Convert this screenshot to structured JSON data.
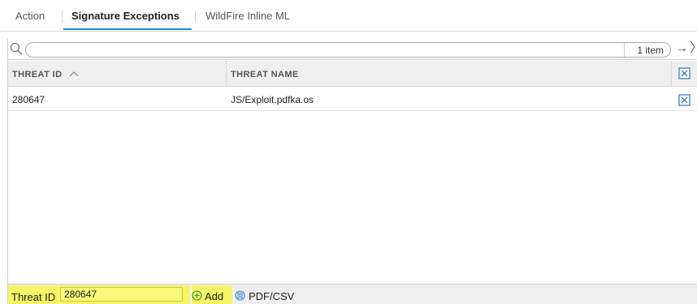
{
  "tabs": [
    {
      "label": "Action"
    },
    {
      "label": "Signature Exceptions"
    },
    {
      "label": "WildFire Inline ML"
    }
  ],
  "search": {
    "value": "",
    "placeholder": "",
    "item_count": "1 item"
  },
  "table": {
    "columns": [
      "THREAT ID",
      "THREAT NAME"
    ],
    "rows": [
      {
        "threat_id": "280647",
        "threat_name": "JS/Exploit.pdfka.os"
      }
    ]
  },
  "footer": {
    "threat_label": "Threat ID",
    "threat_value": "280647",
    "add_label": "Add",
    "pdf_label": "PDF/CSV"
  },
  "colors": {
    "accent": "#1a8fbf",
    "highlight": "#f5f565",
    "icon_blue": "#3a7fc8",
    "icon_green": "#2e8b3d"
  },
  "icons": [
    "search-icon",
    "arrow-right-icon",
    "chevron-right-icon",
    "sort-asc-icon",
    "checkbox-icon",
    "add-icon",
    "pdf-icon"
  ]
}
